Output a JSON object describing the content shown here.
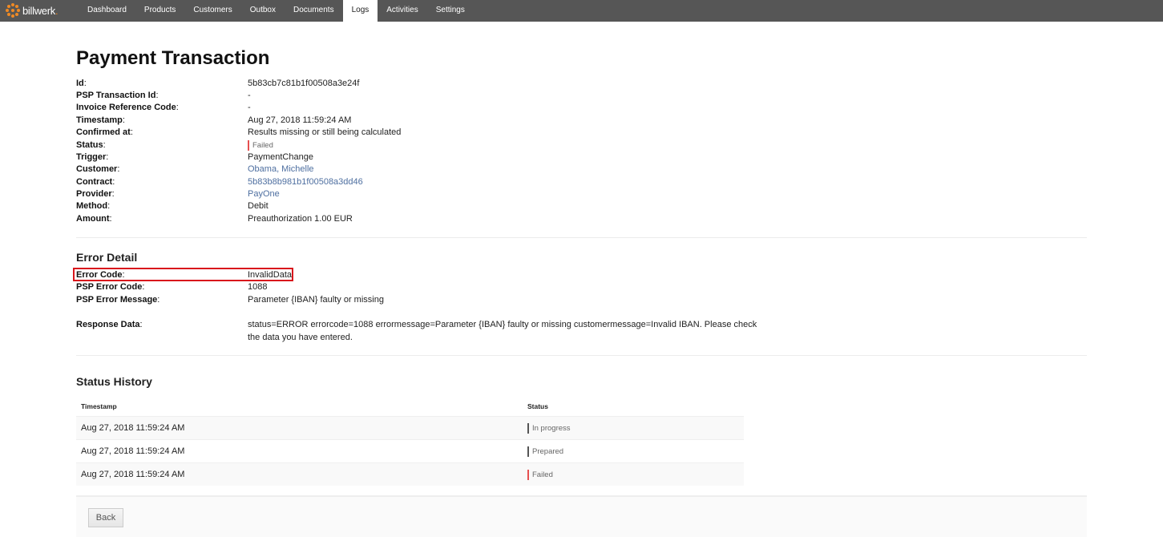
{
  "nav": {
    "brand": "billwerk",
    "brand_dot": ".",
    "items": [
      {
        "label": "Dashboard",
        "active": false
      },
      {
        "label": "Products",
        "active": false
      },
      {
        "label": "Customers",
        "active": false
      },
      {
        "label": "Outbox",
        "active": false
      },
      {
        "label": "Documents",
        "active": false
      },
      {
        "label": "Logs",
        "active": true
      },
      {
        "label": "Activities",
        "active": false
      },
      {
        "label": "Settings",
        "active": false
      }
    ]
  },
  "page": {
    "title": "Payment Transaction"
  },
  "details": {
    "fields": [
      {
        "label": "Id",
        "value": "5b83cb7c81b1f00508a3e24f"
      },
      {
        "label": "PSP Transaction Id",
        "value": "-"
      },
      {
        "label": "Invoice Reference Code",
        "value": "-"
      },
      {
        "label": "Timestamp",
        "value": "Aug 27, 2018 11:59:24 AM"
      },
      {
        "label": "Confirmed at",
        "value": "Results missing or still being calculated"
      },
      {
        "label": "Status",
        "value": "Failed"
      },
      {
        "label": "Trigger",
        "value": "PaymentChange"
      },
      {
        "label": "Customer",
        "value": "Obama, Michelle"
      },
      {
        "label": "Contract",
        "value": "5b83b8b981b1f00508a3dd46"
      },
      {
        "label": "Provider",
        "value": "PayOne"
      },
      {
        "label": "Method",
        "value": "Debit"
      },
      {
        "label": "Amount",
        "value": "Preauthorization 1.00 EUR"
      }
    ]
  },
  "error_detail": {
    "title": "Error Detail",
    "fields": [
      {
        "label": "Error Code",
        "value": "InvalidData"
      },
      {
        "label": "PSP Error Code",
        "value": "1088"
      },
      {
        "label": "PSP Error Message",
        "value": "Parameter {IBAN} faulty or missing"
      },
      {
        "label": "Response Data",
        "value": "status=ERROR errorcode=1088 errormessage=Parameter {IBAN} faulty or missing customermessage=Invalid IBAN. Please check the data you have entered."
      }
    ]
  },
  "status_history": {
    "title": "Status History",
    "columns": [
      "Timestamp",
      "Status"
    ],
    "rows": [
      {
        "timestamp": "Aug 27, 2018 11:59:24 AM",
        "status": "In progress"
      },
      {
        "timestamp": "Aug 27, 2018 11:59:24 AM",
        "status": "Prepared"
      },
      {
        "timestamp": "Aug 27, 2018 11:59:24 AM",
        "status": "Failed"
      }
    ]
  },
  "footer": {
    "back_label": "Back"
  },
  "colors": {
    "navbar": "#565656",
    "brand_accent": "#f08a24",
    "link": "#4e6fa0",
    "failed": "#e65050",
    "neutral_status": "#555555",
    "highlight": "#d9161c"
  }
}
